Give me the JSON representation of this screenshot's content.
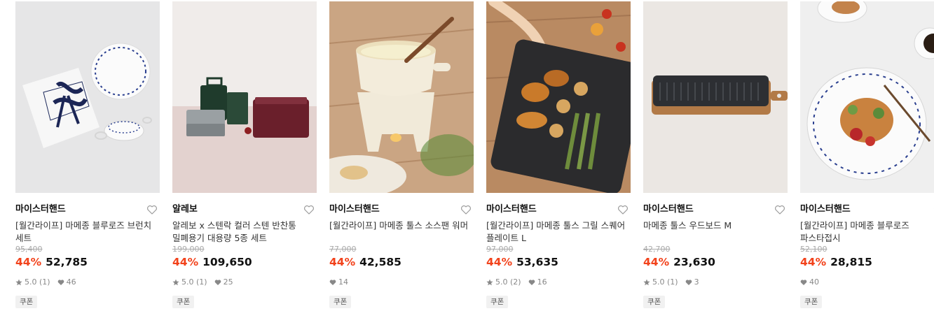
{
  "colors": {
    "discount": "#f2421b",
    "coupon_bg": "#f1f1f1"
  },
  "products": [
    {
      "brand": "마이스터핸드",
      "title": "[월간라이프] 마메종 블루로즈 브런치 세트",
      "original_price": "95,400",
      "discount": "44%",
      "price": "52,785",
      "rating": "5.0 (1)",
      "likes": "46",
      "badge": "쿠폰",
      "has_rating": true,
      "image_icon": "brunch-set-image"
    },
    {
      "brand": "알레보",
      "title": "알레보 x 스텐락 컬러 스텐 반찬통 밀폐용기 대용량 5종 세트",
      "original_price": "199,000",
      "discount": "44%",
      "price": "109,650",
      "rating": "5.0 (1)",
      "likes": "25",
      "badge": "쿠폰",
      "has_rating": true,
      "image_icon": "container-set-image"
    },
    {
      "brand": "마이스터핸드",
      "title": "[월간라이프] 마메종 툴스 소스팬 워머",
      "original_price": "77,000",
      "discount": "44%",
      "price": "42,585",
      "rating": "",
      "likes": "14",
      "badge": "쿠폰",
      "has_rating": false,
      "image_icon": "sauce-warmer-image"
    },
    {
      "brand": "마이스터핸드",
      "title": "[월간라이프] 마메종 툴스 그릴 스퀘어 플레이트 L",
      "original_price": "97,000",
      "discount": "44%",
      "price": "53,635",
      "rating": "5.0 (2)",
      "likes": "16",
      "badge": "쿠폰",
      "has_rating": true,
      "image_icon": "grill-plate-image"
    },
    {
      "brand": "마이스터핸드",
      "title": "마메종 툴스 우드보드 M",
      "original_price": "42,700",
      "discount": "44%",
      "price": "23,630",
      "rating": "5.0 (1)",
      "likes": "3",
      "badge": "쿠폰",
      "has_rating": true,
      "image_icon": "wood-board-image"
    },
    {
      "brand": "마이스터핸드",
      "title": "[월간라이프] 마메종 블루로즈 파스타접시",
      "original_price": "52,100",
      "discount": "44%",
      "price": "28,815",
      "rating": "",
      "likes": "40",
      "badge": "쿠폰",
      "has_rating": false,
      "image_icon": "pasta-plate-image"
    }
  ]
}
